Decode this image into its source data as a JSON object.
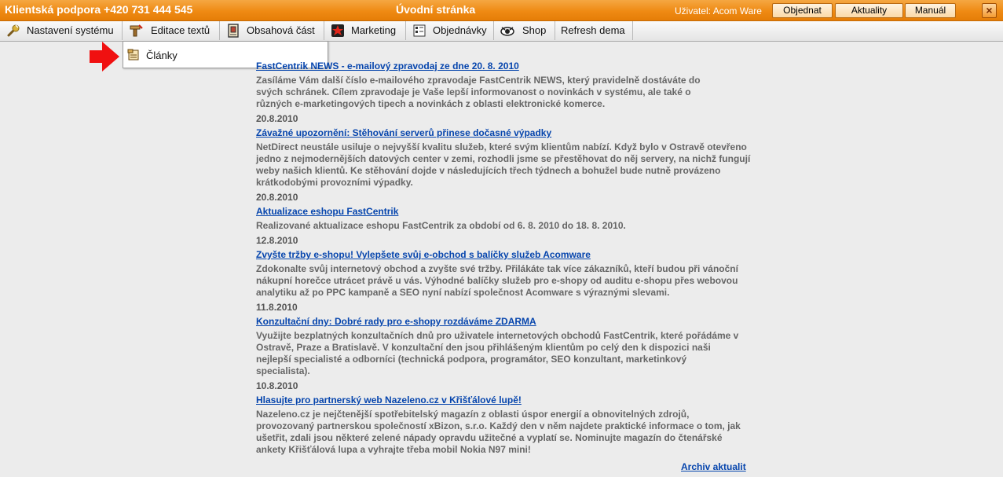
{
  "topbar": {
    "support": "Klientská podpora +420 731 444 545",
    "title": "Úvodní stránka",
    "user_label": "Uživatel:",
    "user_name": "Acom Ware",
    "buttons": {
      "objednat": "Objednat",
      "aktuality": "Aktuality",
      "manual": "Manuál"
    },
    "close": "×"
  },
  "menu": {
    "items": [
      {
        "label": "Nastavení systému",
        "icon": "wrench-icon"
      },
      {
        "label": "Editace textů",
        "icon": "pen-icon"
      },
      {
        "label": "Obsahová část",
        "icon": "document-icon"
      },
      {
        "label": "Marketing",
        "icon": "star-icon"
      },
      {
        "label": "Objednávky",
        "icon": "orders-icon"
      },
      {
        "label": "Shop",
        "icon": "eye-icon"
      },
      {
        "label": "Refresh dema",
        "icon": ""
      }
    ],
    "dropdown": {
      "label": "Články",
      "icon": "article-icon"
    }
  },
  "news": [
    {
      "title": "FastCentrik NEWS - e-mailový zpravodaj ze dne 20. 8. 2010",
      "body": "Zasíláme Vám další číslo e-mailového zpravodaje FastCentrik NEWS, který pravidelně dostáváte do svých schránek. Cílem zpravodaje je Vaše lepší informovanost o novinkách v systému, ale také o různých e-marketingových tipech a novinkách z oblasti elektronické komerce.",
      "date": "20.8.2010"
    },
    {
      "title": "Závažné upozornění: Stěhování serverů přinese dočasné výpadky",
      "body": "NetDirect neustále usiluje o nejvyšší kvalitu služeb, které svým klientům nabízí. Když bylo v Ostravě otevřeno jedno z nejmodernějších datových center v zemi, rozhodli jsme se přestěhovat do něj servery, na nichž fungují weby našich klientů. Ke stěhování dojde v následujících třech týdnech a bohužel bude nutně provázeno krátkodobými provozními výpadky.",
      "date": "20.8.2010"
    },
    {
      "title": "Aktualizace eshopu FastCentrik",
      "body": "Realizované aktualizace eshopu FastCentrik za období od 6. 8. 2010 do 18. 8. 2010.",
      "date": "12.8.2010"
    },
    {
      "title": "Zvyšte tržby e-shopu! Vylepšete svůj e-obchod s balíčky služeb Acomware",
      "body": "Zdokonalte svůj internetový obchod a zvyšte své tržby. Přilákáte tak více zákazníků, kteří budou při vánoční nákupní horečce utrácet právě u vás. Výhodné balíčky služeb pro e-shopy od auditu e-shopu přes webovou analytiku až po PPC kampaně a SEO nyní nabízí společnost Acomware s výraznými slevami.",
      "date": "11.8.2010"
    },
    {
      "title": "Konzultační dny: Dobré rady pro e-shopy rozdáváme ZDARMA",
      "body": "Využijte bezplatných konzultačních dnů pro uživatele internetových obchodů FastCentrik, které pořádáme v Ostravě, Praze a Bratislavě. V konzultační den jsou přihlášeným klientům po celý den k dispozici naši nejlepší specialisté a odborníci (technická podpora, programátor, SEO konzultant, marketinkový specialista).",
      "date": "10.8.2010"
    },
    {
      "title": "Hlasujte pro partnerský web Nazeleno.cz v Křišťálové lupě!",
      "body": "Nazeleno.cz je nejčtenější spotřebitelský magazín z oblasti úspor energií a obnovitelných zdrojů, provozovaný partnerskou společností xBizon, s.r.o. Každý den v něm najdete praktické informace o tom, jak ušetřit, zdali jsou některé zelené nápady opravdu užitečné a vyplatí se. Nominujte magazín do čtenářské ankety Křišťálová lupa a vyhrajte třeba mobil Nokia N97 mini!",
      "date": ""
    }
  ],
  "archive_link": "Archiv aktualit"
}
